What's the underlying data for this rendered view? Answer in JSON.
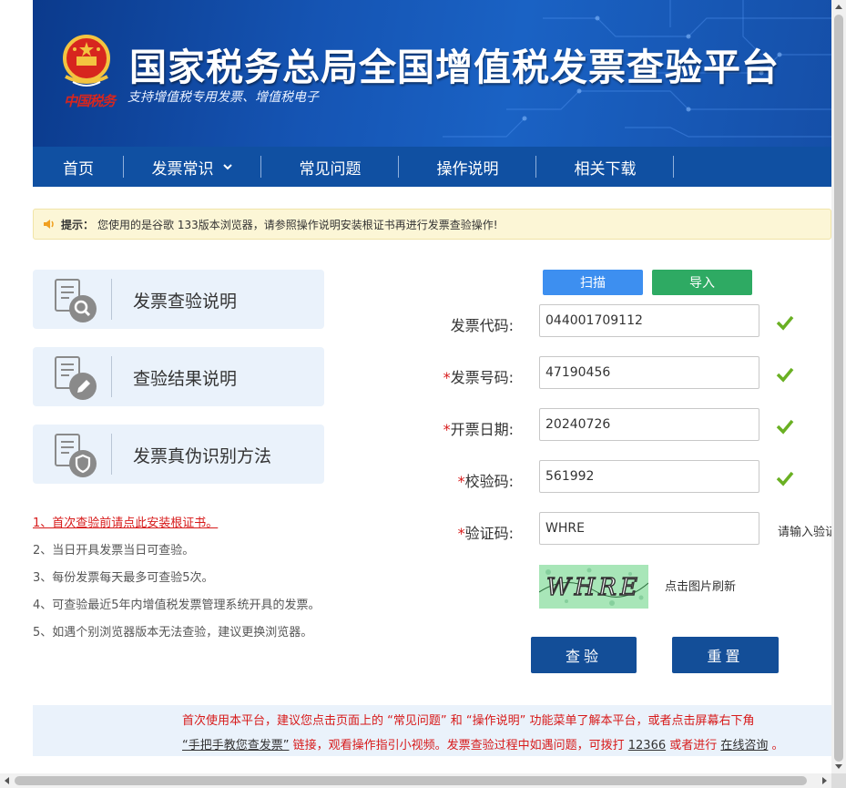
{
  "header": {
    "title": "国家税务总局全国增值税发票查验平台",
    "subtitle": "支持增值税专用发票、增值税电子",
    "emblem_text": "中国税务"
  },
  "nav": {
    "items": [
      {
        "label": "首页"
      },
      {
        "label": "发票常识"
      },
      {
        "label": "常见问题"
      },
      {
        "label": "操作说明"
      },
      {
        "label": "相关下载"
      }
    ]
  },
  "tip": {
    "label": "提示：",
    "text": "您使用的是谷歌 133版本浏览器，请参照操作说明安装根证书再进行发票查验操作!"
  },
  "cards": [
    {
      "label": "发票查验说明",
      "icon": "document-search-icon"
    },
    {
      "label": "查验结果说明",
      "icon": "document-edit-icon"
    },
    {
      "label": "发票真伪识别方法",
      "icon": "document-shield-icon"
    }
  ],
  "notes": [
    "1、首次查验前请点此安装根证书。",
    "2、当日开具发票当日可查验。",
    "3、每份发票每天最多可查验5次。",
    "4、可查验最近5年内增值税发票管理系统开具的发票。",
    "5、如遇个别浏览器版本无法查验，建议更换浏览器。"
  ],
  "form": {
    "scan_label": "扫描",
    "import_label": "导入",
    "fields": [
      {
        "label": "发票代码:",
        "required": "",
        "value": "044001709112"
      },
      {
        "label": "发票号码:",
        "required": "*",
        "value": "47190456"
      },
      {
        "label": "开票日期:",
        "required": "*",
        "value": "20240726"
      },
      {
        "label": "校验码:",
        "required": "*",
        "value": "561992"
      },
      {
        "label": "验证码:",
        "required": "*",
        "value": "WHRE"
      }
    ],
    "captcha_hint": "请输入验证",
    "captcha_text": "WHRE",
    "refresh_label": "点击图片刷新",
    "submit_label": "查验",
    "reset_label": "重置"
  },
  "bottom": {
    "line1": "首次使用本平台，建议您点击页面上的 “常见问题” 和 “操作说明” 功能菜单了解本平台，或者点击屏幕右下角",
    "link_tutorial": "“手把手教您查发票”",
    "line2_mid": " 链接，观看操作指引小视频。发票查验过程中如遇问题，可拨打 ",
    "hotline": "12366",
    "line2_or": " 或者进行 ",
    "link_consult": "在线咨询",
    "line2_end": " 。"
  },
  "colors": {
    "nav_bg": "#1050a2",
    "accent_red": "#d71a1a",
    "scan_blue": "#3d8ff0",
    "import_green": "#2eaa63",
    "button_blue": "#134e98",
    "check_green": "#6ab023"
  }
}
